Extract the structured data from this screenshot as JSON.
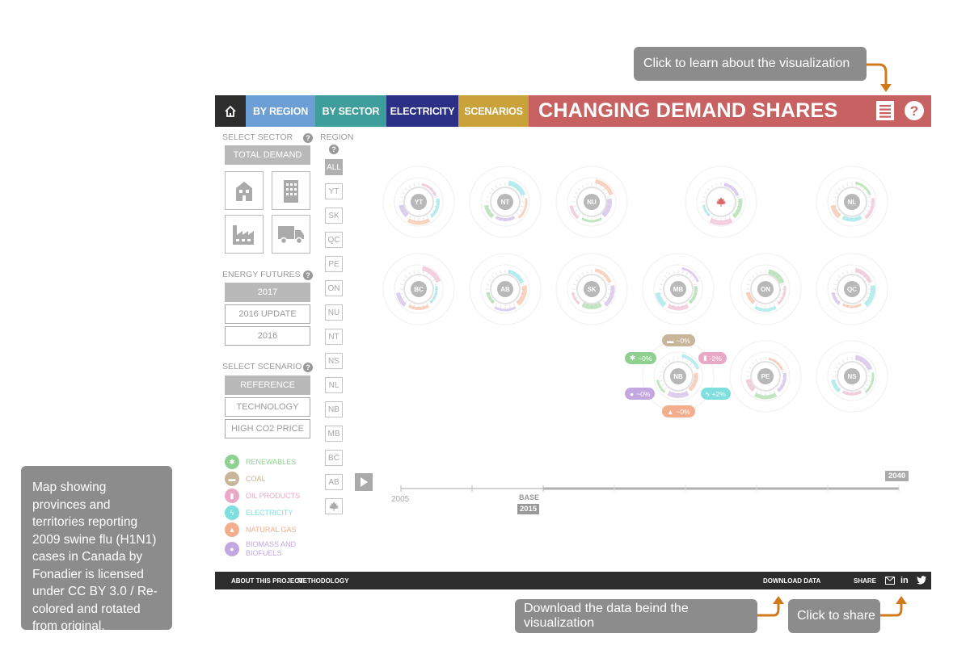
{
  "callouts": {
    "learn": "Click to learn about the visualization",
    "download": "Download the data beind the visualization",
    "share": "Click to share",
    "credit": "Map showing provinces and territories reporting 2009 swine flu (H1N1) cases in Canada by Fonadier is licensed under CC BY 3.0 / Re-colored and rotated from original."
  },
  "nav": {
    "tabs": [
      {
        "label": "BY REGION",
        "color": "#6c9fd6"
      },
      {
        "label": "BY SECTOR",
        "color": "#3d9e9b"
      },
      {
        "label": "ELECTRICITY",
        "color": "#2b2f86"
      },
      {
        "label": "SCENARIOS",
        "color": "#c9a23a"
      }
    ],
    "title": "CHANGING DEMAND SHARES",
    "title_color": "#c86262",
    "icons": [
      "home-icon",
      "list-icon",
      "help-icon"
    ]
  },
  "sidebar": {
    "sector_label": "SELECT SECTOR",
    "total_demand": "TOTAL DEMAND",
    "sector_icons": [
      "residential-icon",
      "commercial-icon",
      "industrial-icon",
      "transportation-icon"
    ],
    "futures_label": "ENERGY FUTURES",
    "futures": [
      "2017",
      "2016 UPDATE",
      "2016"
    ],
    "futures_selected": "2017",
    "scenario_label": "SELECT SCENARIO",
    "scenarios": [
      "REFERENCE",
      "TECHNOLOGY",
      "HIGH CO2 PRICE"
    ],
    "scenario_selected": "REFERENCE",
    "legend": [
      {
        "label": "RENEWABLES",
        "color": "#8fcf8f"
      },
      {
        "label": "COAL",
        "color": "#c9b59a"
      },
      {
        "label": "OIL PRODUCTS",
        "color": "#e9a9c6"
      },
      {
        "label": "ELECTRICITY",
        "color": "#7fdede"
      },
      {
        "label": "NATURAL GAS",
        "color": "#f3ae8e"
      },
      {
        "label": "BIOMASS AND",
        "label2": "BIOFUELS",
        "color": "#c3a8e0"
      }
    ]
  },
  "regions": {
    "label": "REGION",
    "items": [
      "ALL",
      "YT",
      "SK",
      "QC",
      "PE",
      "ON",
      "NU",
      "NT",
      "NS",
      "NL",
      "NB",
      "MB",
      "BC",
      "AB"
    ],
    "selected": "ALL",
    "canada_icon": "maple-leaf-icon"
  },
  "provinces": [
    "YT",
    "NT",
    "NU",
    "CA",
    "NL",
    "BC",
    "AB",
    "SK",
    "MB",
    "ON",
    "QC",
    "NB",
    "PE",
    "NS"
  ],
  "nb_detail": {
    "coal": "~0%",
    "renewables": "~0%",
    "oil": "-2%",
    "biomass": "~0%",
    "electricity": "+2%",
    "gas": "~0%"
  },
  "timeline": {
    "start": "2005",
    "base_label": "BASE",
    "base_year": "2015",
    "end": "2040",
    "play_icon": "play-icon"
  },
  "footer": {
    "about": "ABOUT THIS PROJECT",
    "methodology": "METHODOLOGY",
    "download": "DOWNLOAD DATA",
    "share": "SHARE",
    "share_icons": [
      "email-icon",
      "linkedin-icon",
      "twitter-icon"
    ]
  }
}
